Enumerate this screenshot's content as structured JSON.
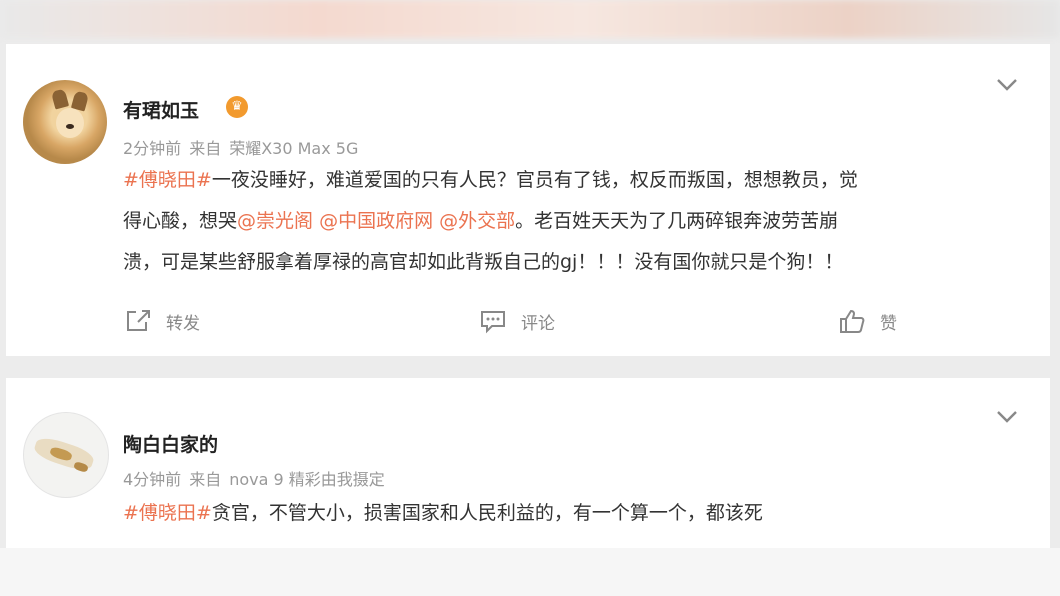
{
  "posts": [
    {
      "username": "有珺如玉",
      "time": "2分钟前",
      "source_prefix": "来自",
      "source": "荣耀X30 Max 5G",
      "tag": "#傅晓田#",
      "text1": "一夜没睡好，难道爱国的只有人民？官员有了钱，权反而叛国，想想教员，觉",
      "text2a": "得心酸，想哭",
      "mention1": "@崇光阁",
      "mention2": "@中国政府网",
      "mention3": "@外交部",
      "text2b": "。老百姓天天为了几两碎银奔波劳苦崩",
      "text3": "溃，可是某些舒服拿着厚禄的高官却如此背叛自己的gj！！！没有国你就只是个狗！！",
      "actions": {
        "repost": "转发",
        "comment": "评论",
        "like": "赞"
      }
    },
    {
      "username": "陶白白家的",
      "time": "4分钟前",
      "source_prefix": "来自",
      "source": "nova 9 精彩由我摄定",
      "tag": "#傅晓田#",
      "text1": "贪官，不管大小，损害国家和人民利益的，有一个算一个，都该死"
    }
  ],
  "icons": {
    "badge": "crown-badge-icon",
    "menu": "chevron-down-icon",
    "repost": "share-icon",
    "comment": "comment-icon",
    "like": "thumbs-up-icon"
  },
  "colors": {
    "accent": "#eb7350",
    "background": "#ececec",
    "card": "#ffffff"
  }
}
